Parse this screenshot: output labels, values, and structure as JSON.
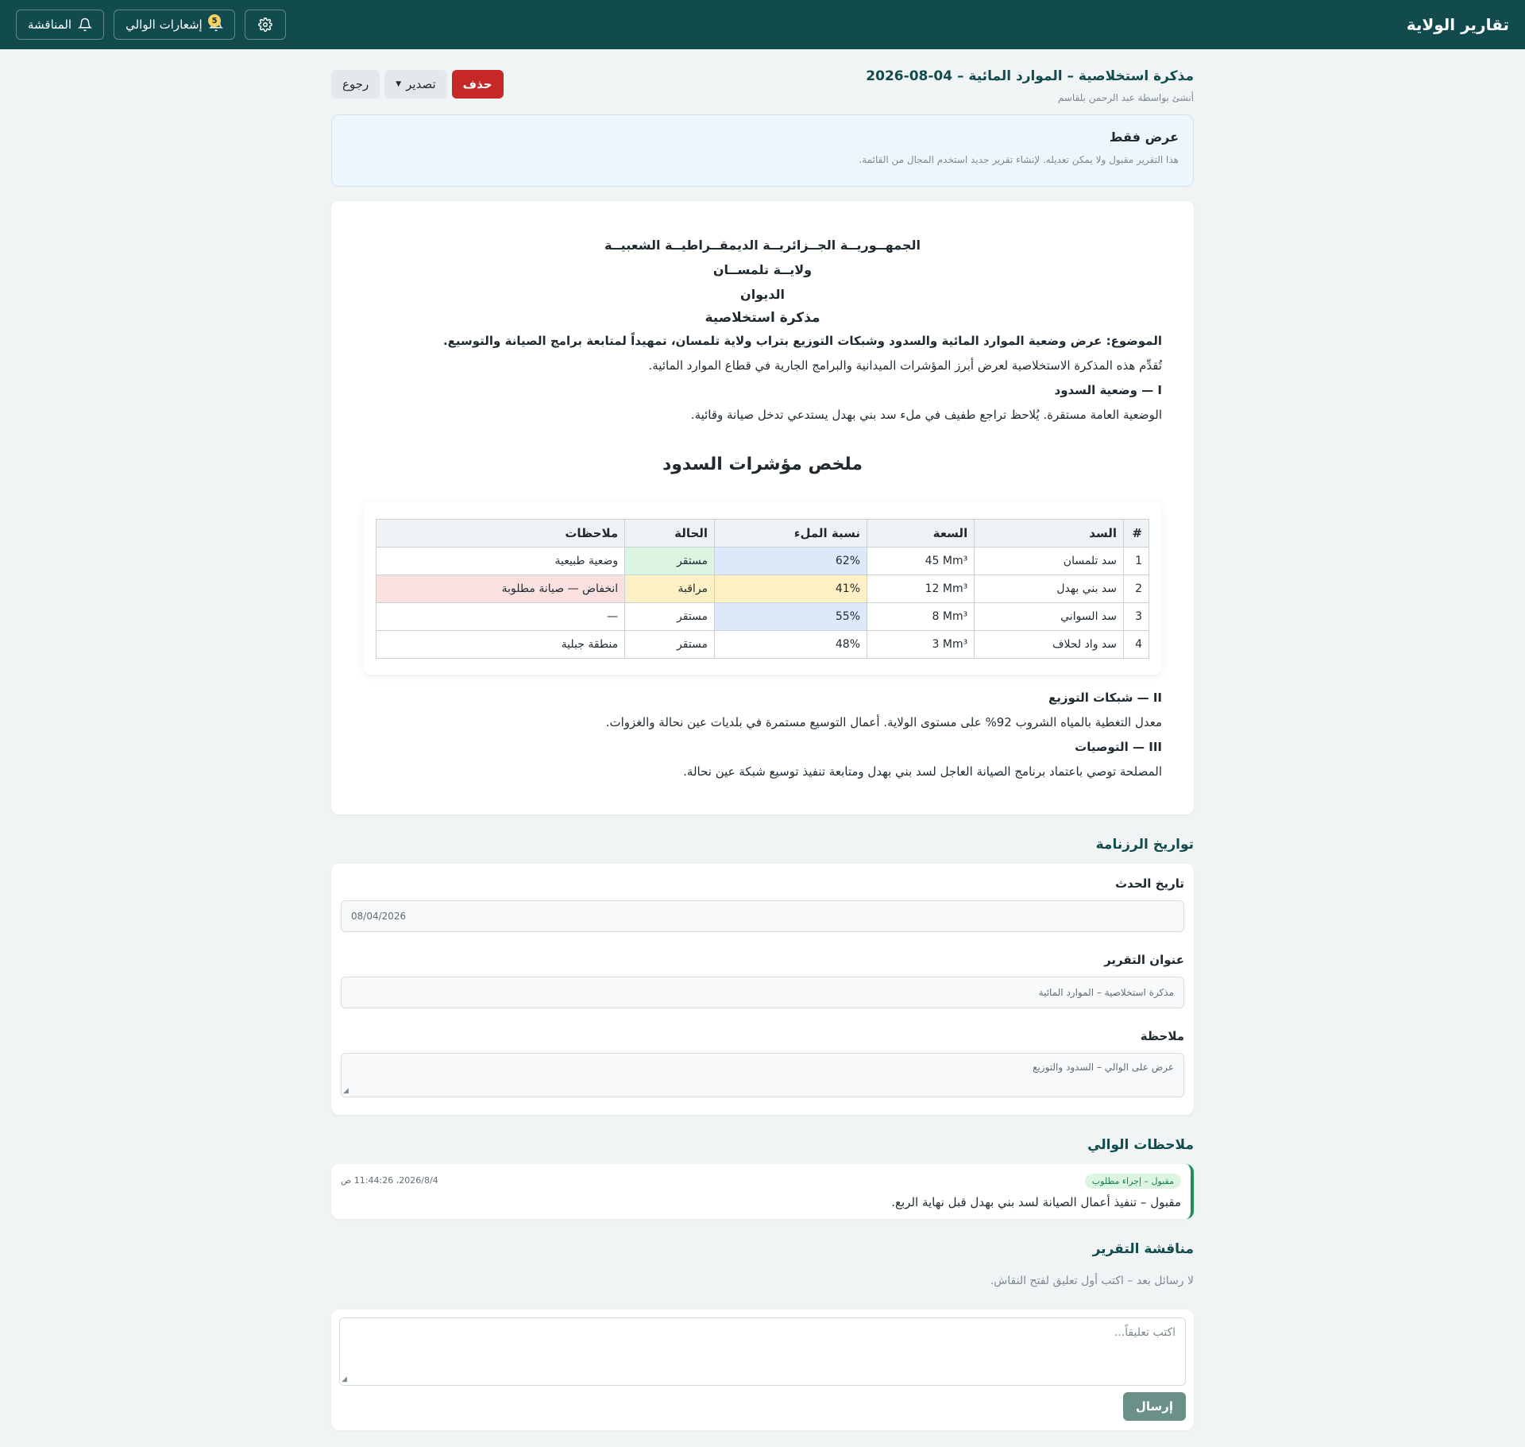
{
  "app": {
    "brand": "تقارير الولاية",
    "discussion_label": "المناقشة",
    "notifications_label": "إشعارات الوالي",
    "notifications_count": "5"
  },
  "report": {
    "title": "مذكرة استخلاصية – الموارد المائية – 04-08-2026",
    "created_by": "أنشئ بواسطة عبد الرحمن بلقاسم",
    "delete_label": "حذف",
    "export_label": "تصدير",
    "back_label": "رجوع"
  },
  "readonly": {
    "title": "عرض فقط",
    "text": "هذا التقرير مقبول ولا يمكن تعديله. لإنشاء تقرير جديد استخدم المجال من القائمة."
  },
  "document": {
    "header_lines": [
      "الجمهــوريــة الجــزائريــة الديمقــراطيــة الشعبيــة",
      "ولايــة تلمســان",
      "الديوان"
    ],
    "doc_title": "مذكرة استخلاصية",
    "subject": "الموضوع: عرض وضعية الموارد المائية والسدود وشبكات التوزيع بتراب ولاية تلمسان، تمهيداً لمتابعة برامج الصيانة والتوسيع.",
    "intro": "تُقدِّم هذه المذكرة الاستخلاصية لعرض أبرز المؤشرات الميدانية والبرامج الجارية في قطاع الموارد المائية.",
    "sec1_title": "I — وضعية السدود",
    "sec1_text": "الوضعية العامة مستقرة. يُلاحظ تراجع طفيف في ملء سد بني بهدل يستدعي تدخل صيانة وقائية.",
    "table_title": "ملخص مؤشرات السدود",
    "table": {
      "headers": [
        "#",
        "السد",
        "السعة",
        "نسبة الملء",
        "الحالة",
        "ملاحظات"
      ],
      "rows": [
        [
          "1",
          "سد تلمسان",
          "45 Mm³",
          "62%",
          "مستقر",
          "وضعية طبيعية"
        ],
        [
          "2",
          "سد بني بهدل",
          "12 Mm³",
          "41%",
          "مراقبة",
          "انخفاض — صيانة مطلوبة"
        ],
        [
          "3",
          "سد السواني",
          "8 Mm³",
          "55%",
          "مستقر",
          "—"
        ],
        [
          "4",
          "سد واد لحلاف",
          "3 Mm³",
          "48%",
          "مستقر",
          "منطقة جبلية"
        ]
      ]
    },
    "sec2_title": "II — شبكات التوزيع",
    "sec2_text": "معدل التغطية بالمياه الشروب 92% على مستوى الولاية. أعمال التوسيع مستمرة في بلديات عين نحالة والغزوات.",
    "sec3_title": "III — التوصيات",
    "sec3_text": "المصلحة توصي باعتماد برنامج الصيانة العاجل لسد بني بهدل ومتابعة تنفيذ توسيع شبكة عين نحالة."
  },
  "calendar": {
    "section_title": "تواريخ الرزنامة",
    "event_date_label": "تاريخ الحدث",
    "event_date_value": "08/04/2026",
    "report_title_label": "عنوان التقرير",
    "report_title_value": "مذكرة استخلاصية – الموارد المائية",
    "note_label": "ملاحظة",
    "note_value": "عرض على الوالي – السدود والتوزيع"
  },
  "governor_notes": {
    "section_title": "ملاحظات الوالي",
    "items": [
      {
        "status": "مقبول – إجراء مطلوب",
        "text": "مقبول – تنفيذ أعمال الصيانة لسد بني بهدل قبل نهاية الربع.",
        "time": "2026/8/4، 11:44:26 ص"
      }
    ]
  },
  "discussion": {
    "section_title": "مناقشة التقرير",
    "empty_text": "لا رسائل بعد – اكتب أول تعليق لفتح النقاش.",
    "comment_placeholder": "اكتب تعليقاً...",
    "send_label": "إرسال"
  },
  "colors": {
    "topbar": "#114b4d",
    "accent": "#114b4d",
    "danger": "#c62828",
    "success": "#1a8f57"
  },
  "icons": [
    "bell-icon",
    "gear-icon",
    "caret-down-icon",
    "resize-grip-icon"
  ]
}
